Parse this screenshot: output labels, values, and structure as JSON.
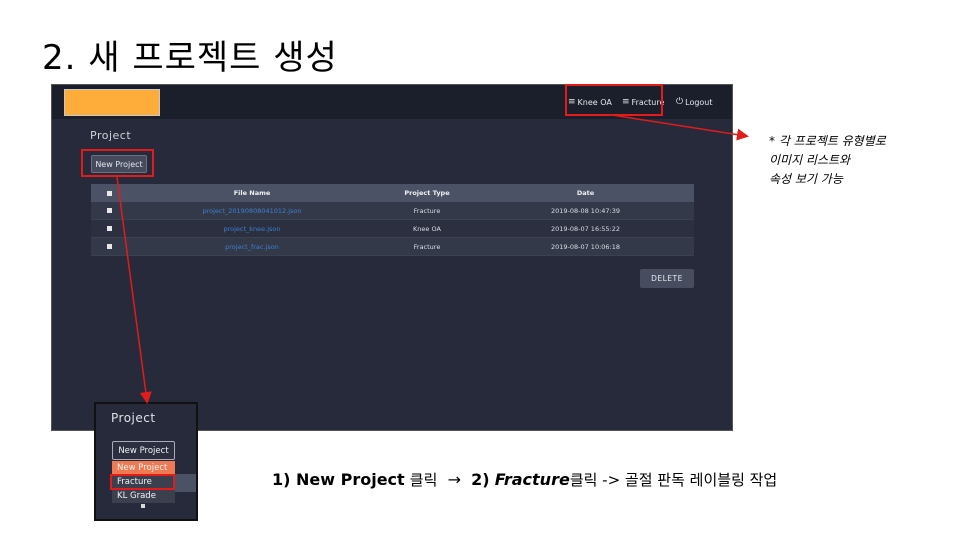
{
  "slide_title": "2. 새 프로젝트 생성",
  "app": {
    "nav": {
      "knee": {
        "icon": "list-icon",
        "label": "Knee OA"
      },
      "fracture": {
        "icon": "list-icon",
        "label": "Fracture"
      },
      "logout": {
        "icon": "power-icon",
        "label": "Logout"
      }
    },
    "heading": "Project",
    "new_project_button": "New Project",
    "table": {
      "headers": [
        "File Name",
        "Project Type",
        "Date"
      ],
      "rows": [
        {
          "file": "project_20190808041012.json",
          "type": "Fracture",
          "date": "2019-08-08 10:47:39"
        },
        {
          "file": "project_knee.json",
          "type": "Knee OA",
          "date": "2019-08-07 16:55:22"
        },
        {
          "file": "project_frac.json",
          "type": "Fracture",
          "date": "2019-08-07 10:06:18"
        }
      ]
    },
    "delete_button": "DELETE",
    "colors": {
      "background": "#262a3a",
      "topbar": "#1b1e2b",
      "logo": "#ffad3a",
      "link": "#3d7fd1",
      "highlight": "#e21b1b",
      "dropdown_hover": "#ef7a52"
    }
  },
  "note": {
    "line1": "* 각 프로젝트 유형별로",
    "line2": "이미지 리스트와",
    "line3": "속성 보기 가능"
  },
  "inset": {
    "title": "Project",
    "button": "New Project",
    "dropdown": [
      "New Project",
      "Fracture",
      "KL Grade"
    ]
  },
  "steps": {
    "s1_bold": "1) New Project",
    "s1_rest": "클릭",
    "arrow": "→",
    "s2_num": "2)",
    "s2_bold": "Fracture",
    "s2_rest": "클릭 -> 골절 판독 레이블링 작업"
  }
}
